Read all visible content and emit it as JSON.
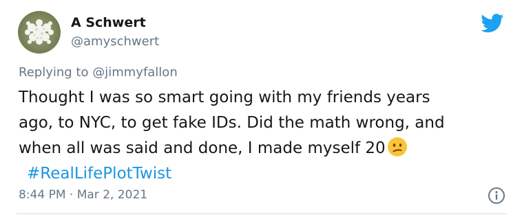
{
  "colors": {
    "accent": "#1da1f2",
    "hashtag": "#1b95e0",
    "text": "#14171a",
    "muted": "#657786",
    "emoji_face": "#fbc33a"
  },
  "user": {
    "display_name": "A Schwert",
    "handle": "@amyschwert",
    "avatar_icon": "flower-avatar"
  },
  "reply": {
    "prefix": "Replying to",
    "handle": "@jimmyfallon"
  },
  "tweet": {
    "lines": [
      "Thought I was so smart going with my friends years",
      "ago, to NYC, to get fake IDs. Did the math wrong, and",
      "when all was said and done, I made myself 20"
    ],
    "emoji": "confused-face",
    "hashtag": "#RealLifePlotTwist"
  },
  "meta": {
    "timestamp": "8:44 PM · Mar 2, 2021"
  },
  "icons": {
    "brand": "twitter-bird-icon",
    "info": "info-icon"
  }
}
